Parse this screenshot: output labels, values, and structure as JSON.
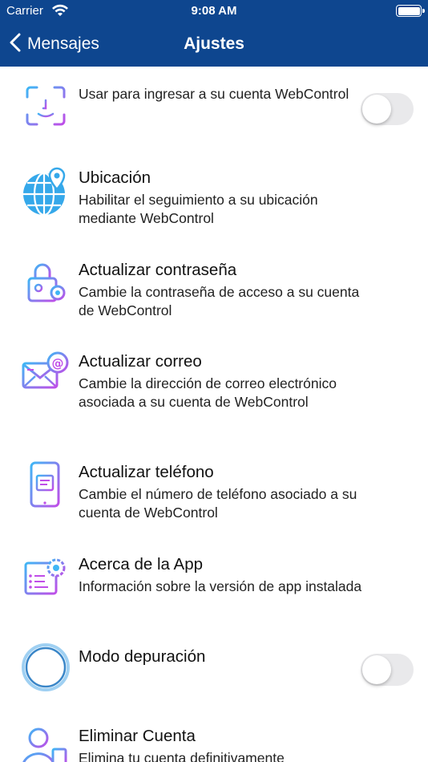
{
  "status": {
    "carrier": "Carrier",
    "time": "9:08 AM"
  },
  "nav": {
    "back_label": "Mensajes",
    "title": "Ajustes"
  },
  "colors": {
    "navbar": "#0e468f",
    "toggle_off": "#e9e9eb"
  },
  "settings": [
    {
      "icon": "face-id-icon",
      "title": "",
      "subtitle": "Usar  para ingresar a su cuenta WebControl",
      "toggle": false
    },
    {
      "icon": "globe-location-icon",
      "title": "Ubicación",
      "subtitle": "Habilitar el seguimiento a su ubicación mediante WebControl"
    },
    {
      "icon": "lock-key-icon",
      "title": "Actualizar contraseña",
      "subtitle": "Cambie la contraseña de acceso a su cuenta de WebControl"
    },
    {
      "icon": "envelope-at-icon",
      "title": "Actualizar correo",
      "subtitle": "Cambie la dirección de correo electrónico asociada a su cuenta de WebControl"
    },
    {
      "icon": "phone-icon",
      "title": "Actualizar teléfono",
      "subtitle": "Cambie el número de teléfono asociado a su cuenta de WebControl"
    },
    {
      "icon": "app-info-gear-icon",
      "title": "Acerca de la App",
      "subtitle": "Información sobre la versión de app instalada"
    },
    {
      "icon": "debug-circle-icon",
      "title": "Modo depuración",
      "subtitle": "",
      "toggle": false
    },
    {
      "icon": "delete-account-icon",
      "title": "Eliminar Cuenta",
      "subtitle": "Elimina tu cuenta definitivamente"
    }
  ]
}
